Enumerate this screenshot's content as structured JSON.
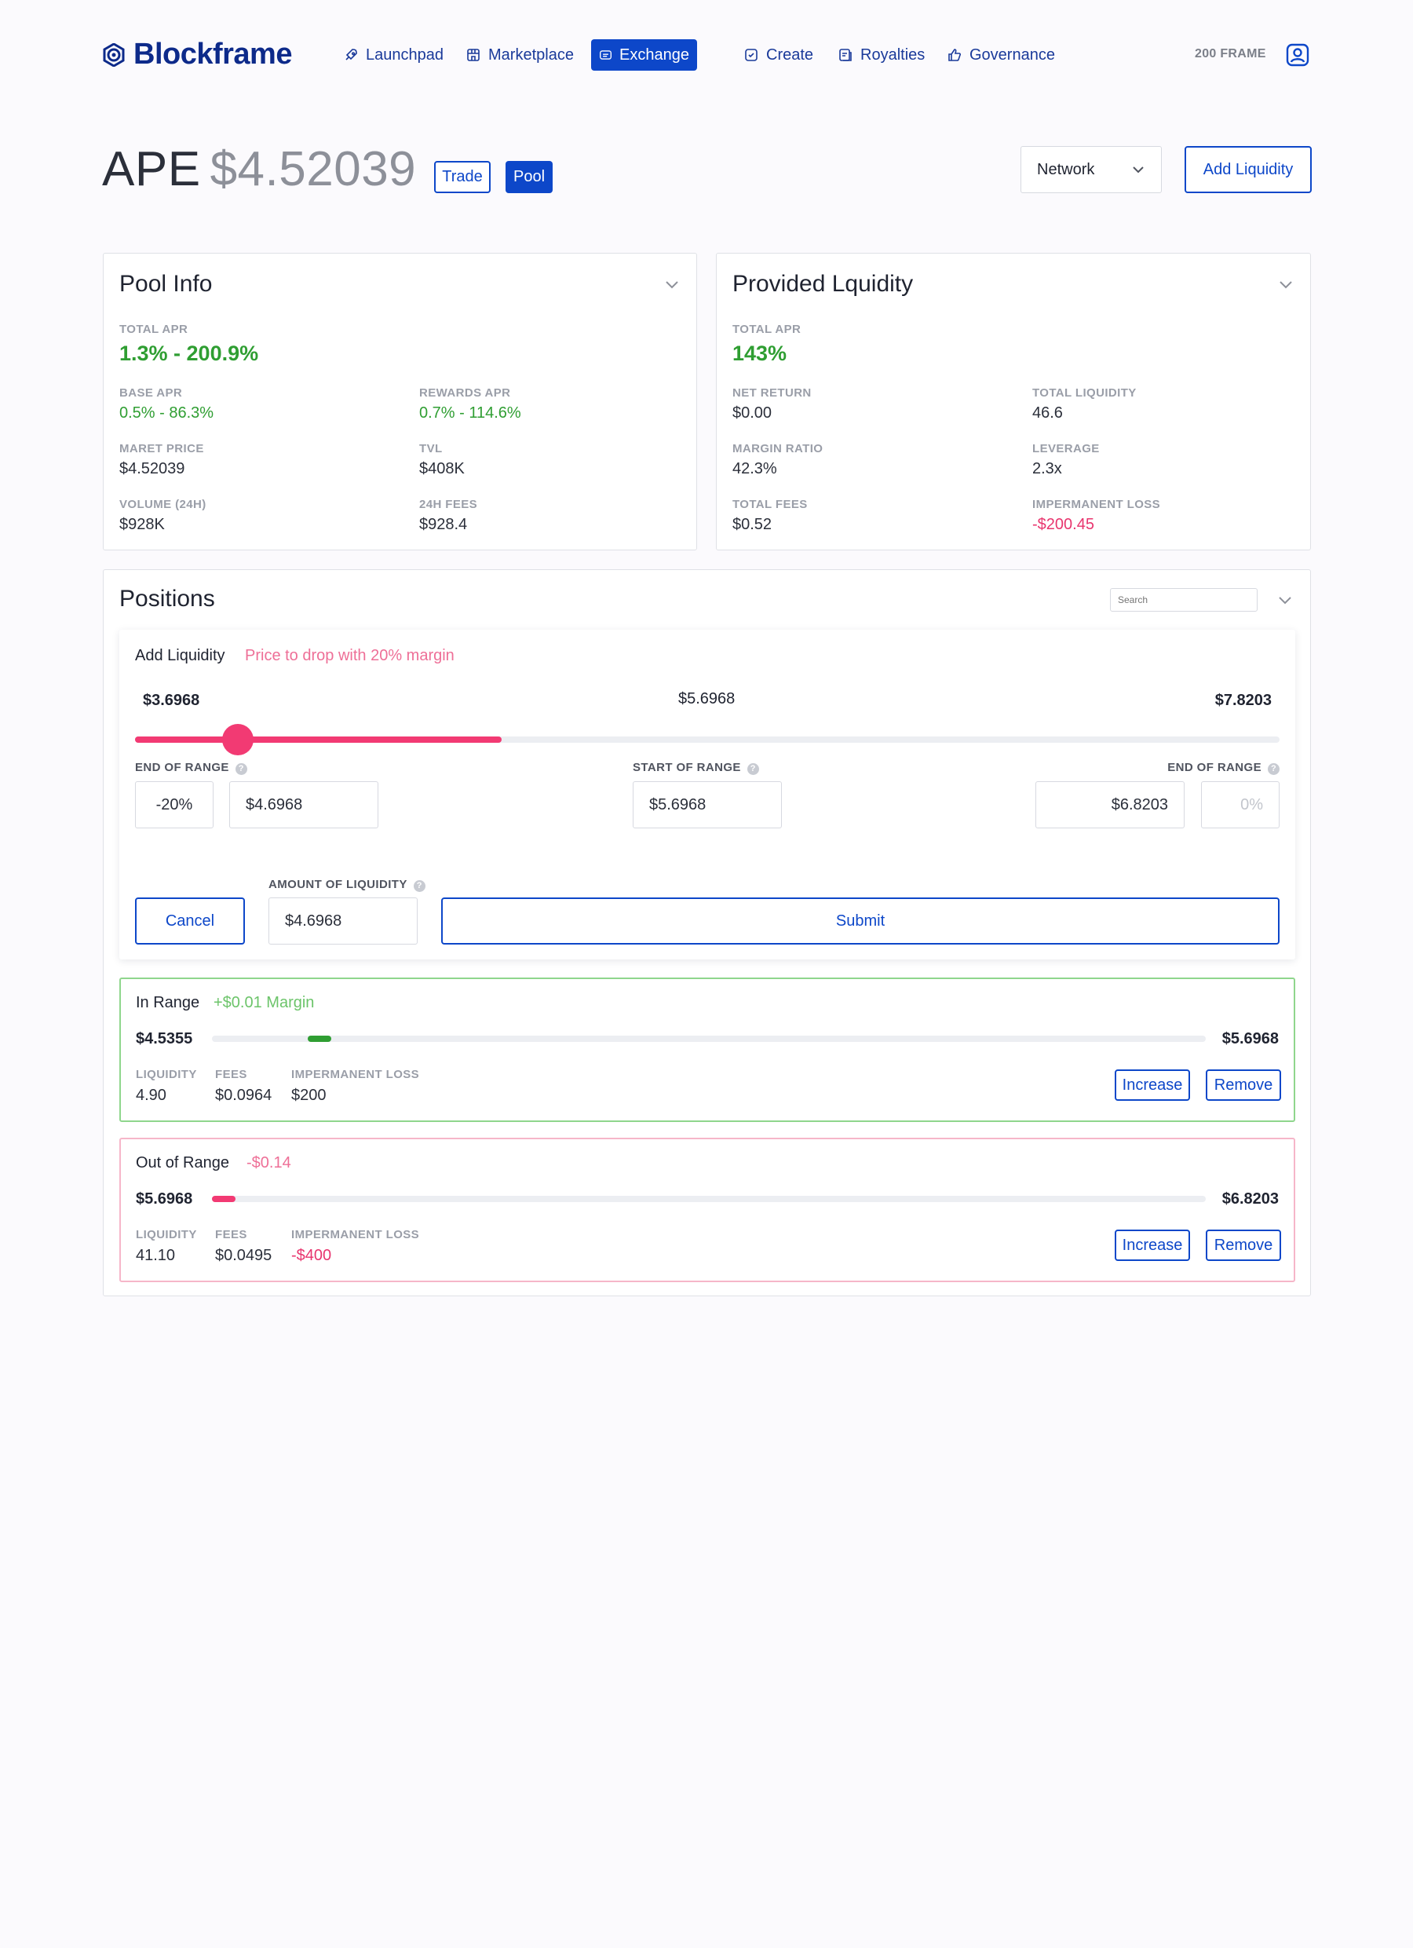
{
  "app": {
    "name": "Blockframe",
    "balance": "200 FRAME"
  },
  "nav": {
    "launchpad": "Launchpad",
    "marketplace": "Marketplace",
    "exchange": "Exchange",
    "create": "Create",
    "royalties": "Royalties",
    "governance": "Governance"
  },
  "header": {
    "ticker": "APE",
    "price": "$4.52039",
    "trade_label": "Trade",
    "pool_label": "Pool",
    "network_label": "Network",
    "add_liquidity_label": "Add Liquidity"
  },
  "pool_info": {
    "title": "Pool Info",
    "total_apr_label": "TOTAL APR",
    "total_apr": "1.3% - 200.9%",
    "base_apr_label": "BASE APR",
    "base_apr": "0.5% - 86.3%",
    "rewards_apr_label": "REWARDS APR",
    "rewards_apr": "0.7% - 114.6%",
    "market_price_label": "MARET PRICE",
    "market_price": "$4.52039",
    "tvl_label": "TVL",
    "tvl": "$408K",
    "volume_label": "VOLUME (24H)",
    "volume": "$928K",
    "fees_label": "24H FEES",
    "fees": "$928.4"
  },
  "provided_liquidity": {
    "title": "Provided Lquidity",
    "total_apr_label": "TOTAL APR",
    "total_apr": "143%",
    "net_return_label": "NET RETURN",
    "net_return": "$0.00",
    "total_liquidity_label": "TOTAL LIQUIDITY",
    "total_liquidity": "46.6",
    "margin_ratio_label": "MARGIN RATIO",
    "margin_ratio": "42.3%",
    "leverage_label": "LEVERAGE",
    "leverage": "2.3x",
    "total_fees_label": "TOTAL FEES",
    "total_fees": "$0.52",
    "impermanent_loss_label": "IMPERMANENT LOSS",
    "impermanent_loss": "-$200.45"
  },
  "positions": {
    "title": "Positions",
    "search_placeholder": "Search",
    "add_liquidity": {
      "title": "Add Liquidity",
      "hint": "Price to drop with 20% margin",
      "min_price": "$3.6968",
      "mid_price": "$5.6968",
      "max_price": "$7.8203",
      "slider_fill_fraction": 0.32,
      "slider_knob_fraction": 0.09,
      "end_of_range_label": "END OF RANGE",
      "end_pct": "-20%",
      "end_value": "$4.6968",
      "start_of_range_label": "START OF RANGE",
      "start_value": "$5.6968",
      "end_of_range_right_label": "END OF RANGE",
      "end_right_value": "$6.8203",
      "end_right_pct_placeholder": "0%",
      "amount_label": "AMOUNT OF LIQUIDITY",
      "amount_value": "$4.6968",
      "cancel_label": "Cancel",
      "submit_label": "Submit"
    },
    "in_range": {
      "title": "In Range",
      "margin": "+$0.01 Margin",
      "low": "$4.5355",
      "high": "$5.6968",
      "liquidity_label": "LIQUIDITY",
      "liquidity": "4.90",
      "fees_label": "FEES",
      "fees": "$0.0964",
      "il_label": "IMPERMANENT LOSS",
      "il": "$200",
      "increase_label": "Increase",
      "remove_label": "Remove"
    },
    "out_of_range": {
      "title": "Out of Range",
      "margin": "-$0.14",
      "low": "$5.6968",
      "high": "$6.8203",
      "liquidity_label": "LIQUIDITY",
      "liquidity": "41.10",
      "fees_label": "FEES",
      "fees": "$0.0495",
      "il_label": "IMPERMANENT LOSS",
      "il": "-$400",
      "increase_label": "Increase",
      "remove_label": "Remove"
    }
  },
  "colors": {
    "brand": "#0d47c9",
    "positive": "#2f9e32",
    "negative": "#e8356e"
  }
}
